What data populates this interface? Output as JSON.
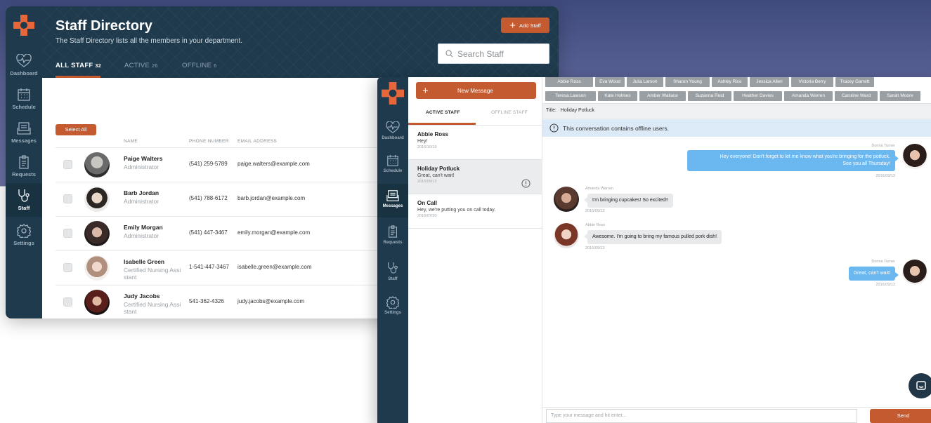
{
  "nav": {
    "items": [
      {
        "label": "Dashboard",
        "icon": "heart-pulse-icon"
      },
      {
        "label": "Schedule",
        "icon": "calendar-icon"
      },
      {
        "label": "Messages",
        "icon": "chat-icon"
      },
      {
        "label": "Requests",
        "icon": "clipboard-icon"
      },
      {
        "label": "Staff",
        "icon": "stethoscope-icon"
      },
      {
        "label": "Settings",
        "icon": "gear-icon"
      }
    ],
    "brand_color": "#c45a30",
    "rail_color": "#1e3a4c"
  },
  "directory": {
    "title": "Staff Directory",
    "subtitle": "The Staff Directory lists all the members in your department.",
    "add_button": "Add Staff",
    "search_placeholder": "Search Staff",
    "tabs": [
      {
        "label": "ALL STAFF",
        "count": "32"
      },
      {
        "label": "ACTIVE",
        "count": "26"
      },
      {
        "label": "OFFLINE",
        "count": "6"
      }
    ],
    "select_all": "Select All",
    "columns": {
      "name": "NAME",
      "phone": "PHONE NUMBER",
      "email": "EMAIL ADDRESS"
    },
    "rows": [
      {
        "name": "Paige Walters",
        "role": "Administrator",
        "phone": "(541) 259-5789",
        "email": "paige.walters@example.com"
      },
      {
        "name": "Barb Jordan",
        "role": "Administrator",
        "phone": "(541) 788-6172",
        "email": "barb.jordan@example.com"
      },
      {
        "name": "Emily Morgan",
        "role": "Administrator",
        "phone": "(541) 447-3467",
        "email": "emily.morgan@example.com"
      },
      {
        "name": "Isabelle Green",
        "role": "Certified Nursing Assi stant",
        "phone": "1-541-447-3467",
        "email": "isabelle.green@example.com"
      },
      {
        "name": "Judy Jacobs",
        "role": "Certified Nursing Assi stant",
        "phone": "541-362-4326",
        "email": "judy.jacobs@example.com"
      }
    ]
  },
  "messages": {
    "new_button": "New Message",
    "tabs": {
      "active": "ACTIVE STAFF",
      "offline": "OFFLINE STAFF"
    },
    "conversations": [
      {
        "title": "Abbie Ross",
        "preview": "Hey!",
        "date": "2016/10/19"
      },
      {
        "title": "Holiday Potluck",
        "preview": "Great, can't wait!",
        "date": "2016/09/13"
      },
      {
        "title": "On Call",
        "preview": "Hey, we're putting you on call today.",
        "date": "2016/07/20"
      }
    ],
    "recipients": [
      "Abbie Ross",
      "Eva Wood",
      "Julia Larson",
      "Sharon Young",
      "Ashley Rice",
      "Jessica Allen",
      "Victoria Berry",
      "Tracey Garrett",
      "Teresa Lawson",
      "Kate Holmes",
      "Amber Wallace",
      "Suzanna Reid",
      "Heather Davies",
      "Amanda Warren",
      "Caroline Ward",
      "Sarah Moore"
    ],
    "title_label": "Title:",
    "title_value": "Holiday Potluck",
    "offline_notice": "This conversation contains offline users.",
    "thread": [
      {
        "sender": "Donna Turner",
        "text_1": "Hey everyone! Don't forget to let me know what you're bringing for the potluck.",
        "text_2": "See you all Thursday!",
        "date": "2016/09/13"
      },
      {
        "sender": "Amanda Warren",
        "text": "I'm bringing cupcakes! So excited!!",
        "date": "2016/09/13"
      },
      {
        "sender": "Abbie Ross",
        "text": "Awesome. I'm going to bring my famous pulled pork dish!",
        "date": "2016/09/13"
      },
      {
        "sender": "Donna Turner",
        "text": "Great, can't wait!",
        "date": "2016/09/13"
      }
    ],
    "composer_placeholder": "Type your message and hit enter...",
    "send": "Send",
    "outgoing_color": "#6bb7f0"
  }
}
